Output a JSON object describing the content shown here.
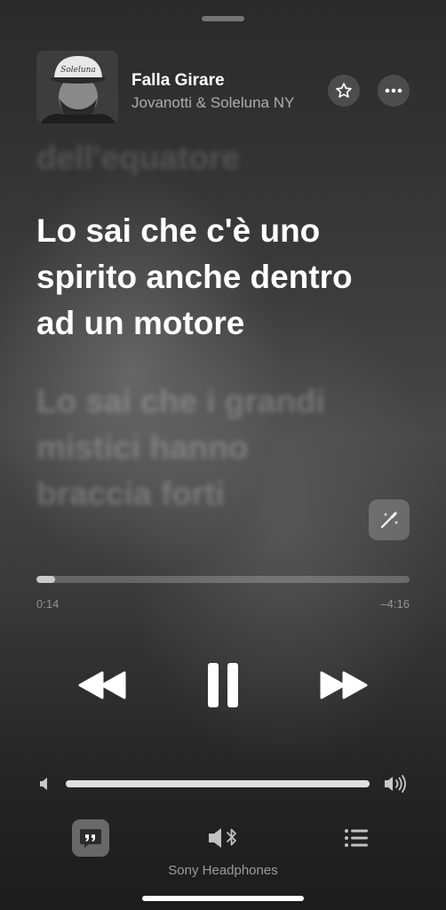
{
  "now_playing": {
    "title": "Falla Girare",
    "artist": "Jovanotti & Soleluna NY",
    "album_art": "artist-photo-with-cap",
    "cap_text": "Soleluna"
  },
  "lyrics": {
    "previous_line": "dell'equatore",
    "current_lines": [
      "Lo sai che c'è uno",
      "spirito anche dentro",
      "ad un motore"
    ],
    "next_lines": [
      "Lo sai che i grandi",
      "mistici hanno",
      "braccia forti"
    ]
  },
  "playback": {
    "elapsed": "0:14",
    "remaining": "–4:16",
    "progress_fraction": 0.05,
    "state": "playing"
  },
  "volume": {
    "level_fraction": 1.0
  },
  "output_device": "Sony Headphones",
  "icons": {
    "favorite": "star-icon",
    "more": "ellipsis-icon",
    "lyrics_effects": "magic-wand-icon",
    "rewind": "rewind-icon",
    "pause": "pause-icon",
    "fast_forward": "fast-forward-icon",
    "volume_low": "speaker-low-icon",
    "volume_high": "speaker-high-icon",
    "lyrics": "lyrics-quote-icon",
    "airplay": "bluetooth-speaker-icon",
    "queue": "queue-list-icon"
  }
}
